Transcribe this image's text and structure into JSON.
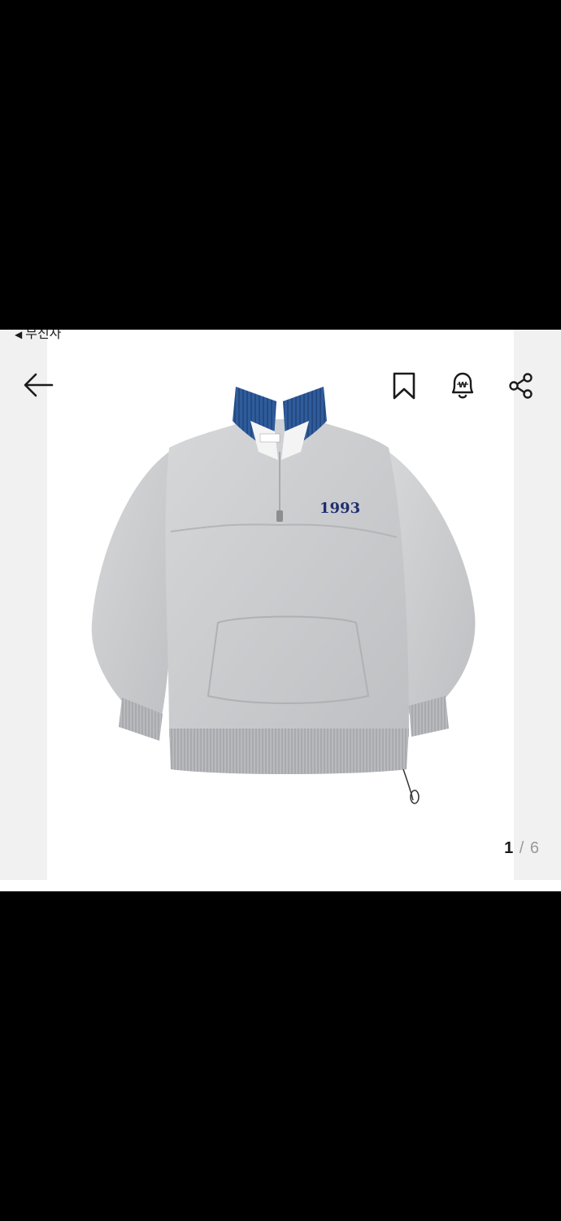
{
  "status_bar": {
    "back_app_label": "무신사"
  },
  "toolbar": {
    "back_icon": "arrow-left-icon",
    "bookmark_icon": "bookmark-icon",
    "price_alert_icon": "won-bell-icon",
    "share_icon": "share-icon",
    "price_alert_glyph": "W"
  },
  "product_image": {
    "alt": "product photo",
    "print_text": "1993",
    "colors": {
      "body": "#c9cacc",
      "collar": "#2e5a9a",
      "print": "#1f2f6e"
    }
  },
  "gallery": {
    "current": "1",
    "separator": "/",
    "total": "6"
  }
}
